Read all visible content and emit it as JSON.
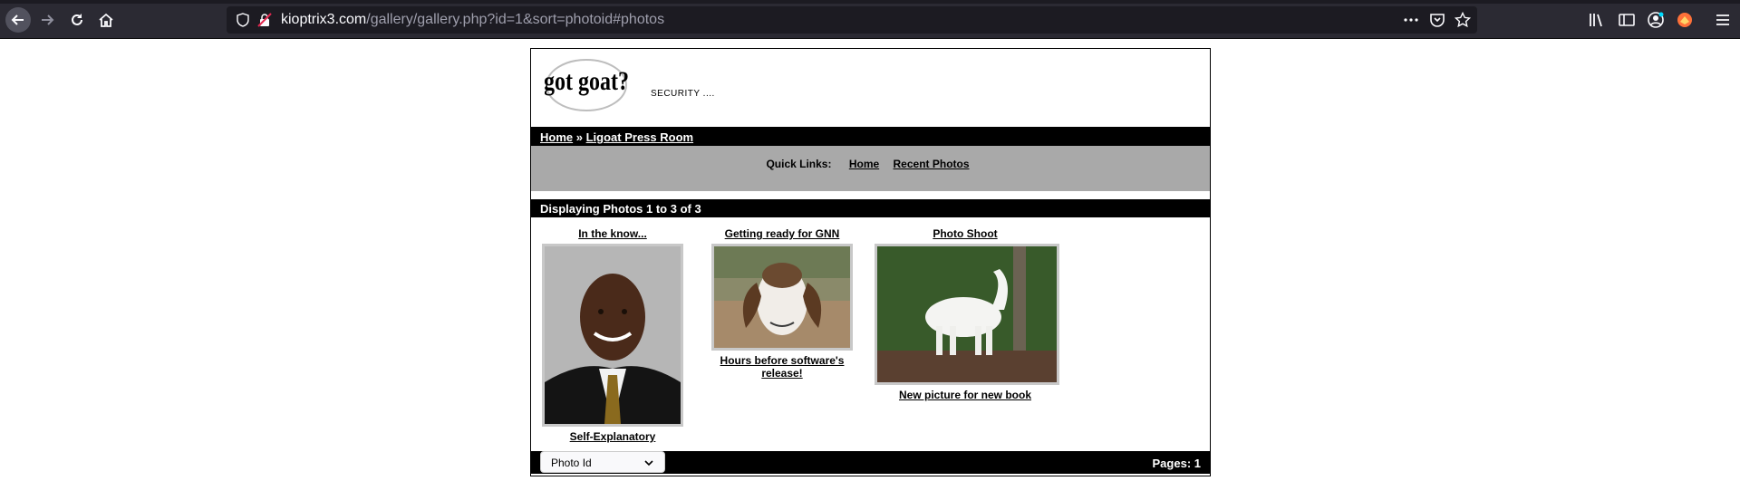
{
  "browser": {
    "url_host": "kioptrix3.com",
    "url_path": "/gallery/gallery.php?id=1&sort=photoid#photos"
  },
  "site": {
    "logo_text": "got goat?",
    "tagline": "SECURITY ...."
  },
  "breadcrumb": {
    "home": "Home",
    "separator": "»",
    "current": "Ligoat Press Room"
  },
  "quick_links": {
    "label": "Quick Links:",
    "links": [
      "Home",
      "Recent Photos"
    ]
  },
  "display_text": "Displaying Photos 1 to 3 of 3",
  "photos": [
    {
      "title": "In the know...",
      "description": "Self-Explanatory"
    },
    {
      "title": "Getting ready for GNN",
      "description": "Hours before software's release!"
    },
    {
      "title": "Photo Shoot",
      "description": "New picture for new book"
    }
  ],
  "footer": {
    "sort_selected": "Photo Id",
    "pages": "Pages: 1"
  }
}
